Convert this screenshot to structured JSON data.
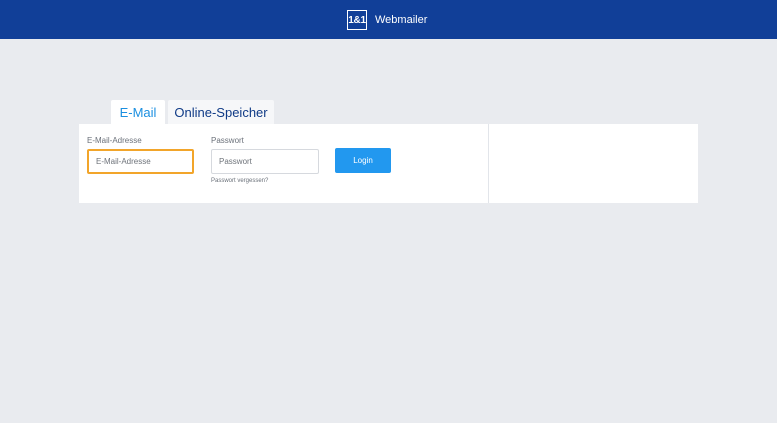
{
  "header": {
    "logo_text": "1&1",
    "app_name": "Webmailer",
    "background_color": "#113f98"
  },
  "tabs": [
    {
      "label": "E-Mail",
      "active": true
    },
    {
      "label": "Online-Speicher",
      "active": false
    }
  ],
  "login_form": {
    "email": {
      "label": "E-Mail-Adresse",
      "placeholder": "E-Mail-Adresse",
      "value": "",
      "focused": true
    },
    "password": {
      "label": "Passwort",
      "placeholder": "Passwort",
      "value": ""
    },
    "login_button": "Login",
    "forgot_password": "Passwort vergessen?"
  },
  "colors": {
    "accent": "#2298ef",
    "focus_border": "#f2a52a",
    "page_background": "#e9ebef"
  }
}
